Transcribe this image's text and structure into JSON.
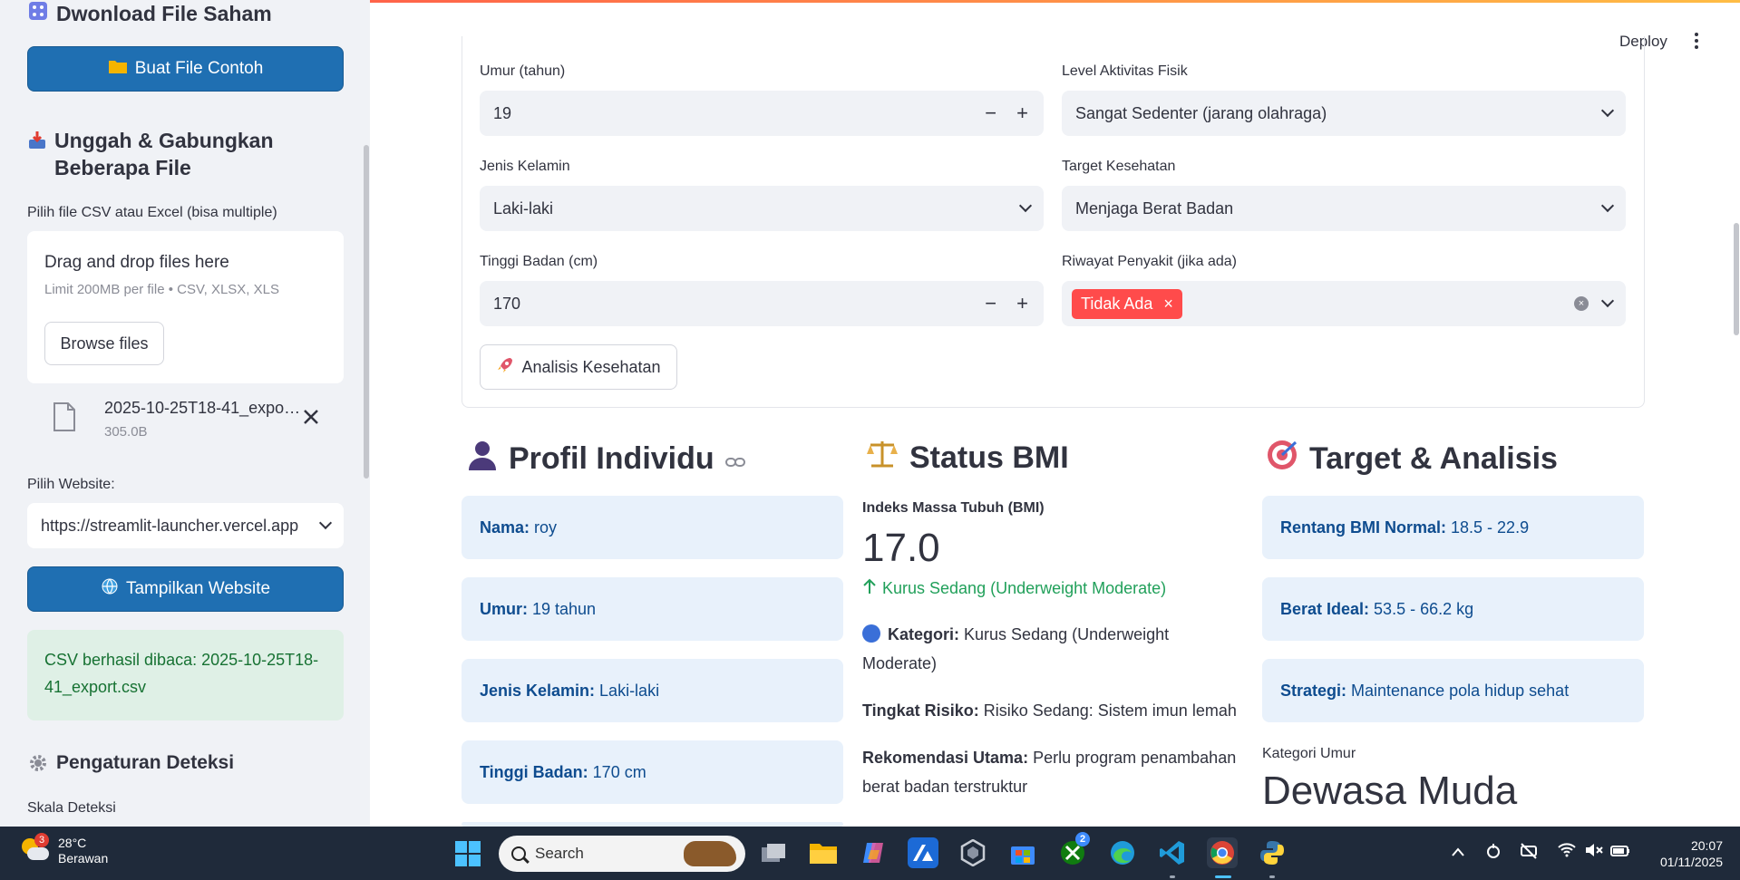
{
  "sidebar": {
    "download_header": "Dwonload File Saham",
    "buat_button": "Buat File Contoh",
    "upload_header": "Unggah & Gabungkan Beberapa File",
    "upload_label": "Pilih file CSV atau Excel (bisa multiple)",
    "dropzone_title": "Drag and drop files here",
    "dropzone_sub": "Limit 200MB per file • CSV, XLSX, XLS",
    "browse_button": "Browse files",
    "file_name": "2025-10-25T18-41_export.csv",
    "file_size": "305.0B",
    "website_label": "Pilih Website:",
    "website_value": "https://streamlit-launcher.vercel.app",
    "tampilkan_button": "Tampilkan Website",
    "success_text": "CSV berhasil dibaca: 2025-10-25T18-41_export.csv",
    "deteksi_header": "Pengaturan Deteksi",
    "skala_label": "Skala Deteksi"
  },
  "header": {
    "deploy": "Deploy"
  },
  "form": {
    "umur_label": "Umur (tahun)",
    "umur_value": "19",
    "aktivitas_label": "Level Aktivitas Fisik",
    "aktivitas_value": "Sangat Sedenter (jarang olahraga)",
    "kelamin_label": "Jenis Kelamin",
    "kelamin_value": "Laki-laki",
    "target_label": "Target Kesehatan",
    "target_value": "Menjaga Berat Badan",
    "tinggi_label": "Tinggi Badan (cm)",
    "tinggi_value": "170",
    "riwayat_label": "Riwayat Penyakit (jika ada)",
    "riwayat_tag": "Tidak Ada",
    "analisis_button": "Analisis Kesehatan"
  },
  "profil": {
    "title": "Profil Individu",
    "items": [
      {
        "k": "Nama:",
        "v": "roy"
      },
      {
        "k": "Umur:",
        "v": "19 tahun"
      },
      {
        "k": "Jenis Kelamin:",
        "v": "Laki-laki"
      },
      {
        "k": "Tinggi Badan:",
        "v": "170 cm"
      }
    ]
  },
  "bmi": {
    "title": "Status BMI",
    "metric_label": "Indeks Massa Tubuh (BMI)",
    "metric_value": "17.0",
    "metric_delta": "Kurus Sedang (Underweight Moderate)",
    "kategori_k": "Kategori:",
    "kategori_v": "Kurus Sedang (Underweight Moderate)",
    "risiko_k": "Tingkat Risiko:",
    "risiko_v": "Risiko Sedang: Sistem imun lemah",
    "rekom_k": "Rekomendasi Utama:",
    "rekom_v": "Perlu program penambahan berat badan terstruktur"
  },
  "target": {
    "title": "Target & Analisis",
    "items": [
      {
        "k": "Rentang BMI Normal:",
        "v": "18.5 - 22.9"
      },
      {
        "k": "Berat Ideal:",
        "v": "53.5 - 66.2 kg"
      },
      {
        "k": "Strategi:",
        "v": "Maintenance pola hidup sehat"
      }
    ],
    "kategori_umur_label": "Kategori Umur",
    "kategori_umur_value": "Dewasa Muda"
  },
  "taskbar": {
    "weather_badge": "3",
    "temperature": "28°C",
    "weather_desc": "Berawan",
    "search_placeholder": "Search",
    "xbox_badge": "2",
    "time": "20:07",
    "date": "01/11/2025"
  }
}
